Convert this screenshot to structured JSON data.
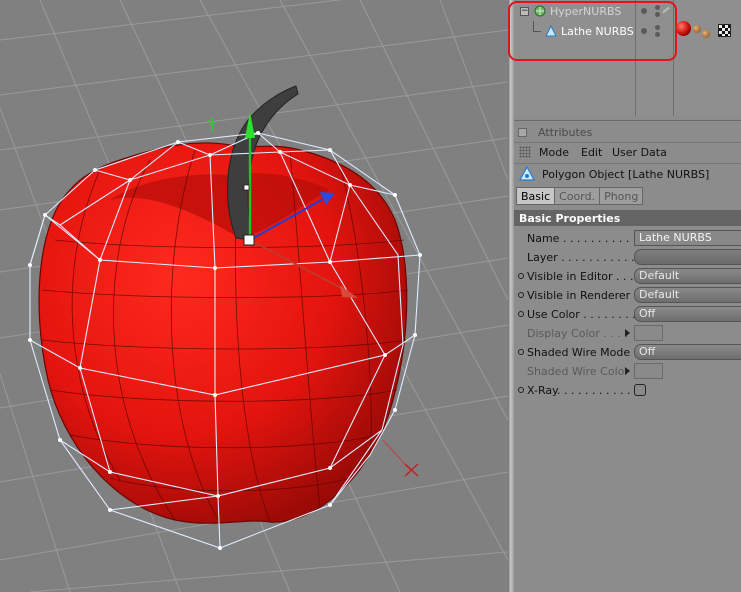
{
  "object_manager": {
    "objects": [
      {
        "name": "HyperNURBS",
        "state": "dimmed"
      },
      {
        "name": "Lathe NURBS",
        "state": "selected"
      }
    ]
  },
  "attributes": {
    "title": "Attributes",
    "menu": [
      "Mode",
      "Edit",
      "User Data"
    ],
    "object_title": "Polygon Object [Lathe NURBS]",
    "tabs": [
      {
        "label": "Basic",
        "active": true
      },
      {
        "label": "Coord.",
        "active": false
      },
      {
        "label": "Phong",
        "active": false
      }
    ],
    "section": "Basic Properties",
    "properties": [
      {
        "label": "Name . . . . . . . . . . . .",
        "value": "Lathe NURBS",
        "kind": "text",
        "animatable": false,
        "enabled": true
      },
      {
        "label": "Layer . . . . . . . . . . . .",
        "value": "",
        "kind": "empty",
        "animatable": false,
        "enabled": true
      },
      {
        "label": "Visible in Editor . . . .",
        "value": "Default",
        "kind": "combo",
        "animatable": true,
        "enabled": true
      },
      {
        "label": "Visible in Renderer . .",
        "value": "Default",
        "kind": "combo",
        "animatable": true,
        "enabled": true
      },
      {
        "label": "Use Color . . . . . . . . .",
        "value": "Off",
        "kind": "combo",
        "animatable": true,
        "enabled": true
      },
      {
        "label": "Display Color . . . .",
        "value": "",
        "kind": "swatch",
        "animatable": false,
        "enabled": false
      },
      {
        "label": "Shaded Wire Mode",
        "value": "Off",
        "kind": "combo",
        "animatable": true,
        "enabled": true
      },
      {
        "label": "Shaded Wire Color",
        "value": "",
        "kind": "swatch",
        "animatable": false,
        "enabled": false
      },
      {
        "label": "X-Ray. . . . . . . . . . . .",
        "value": "",
        "kind": "checkbox",
        "animatable": true,
        "enabled": true
      }
    ]
  },
  "colors": {
    "apple_red": "#e3140e",
    "cage_wire": "#d8e8ff",
    "highlight": "#e0151c",
    "axis_x": "#c0392b",
    "axis_y": "#22c22a",
    "axis_z": "#1f3fd0"
  },
  "icons": [
    "hypernurbs-icon",
    "lathe-nurbs-icon",
    "polygon-object-icon",
    "material-icon",
    "checker-icon"
  ]
}
